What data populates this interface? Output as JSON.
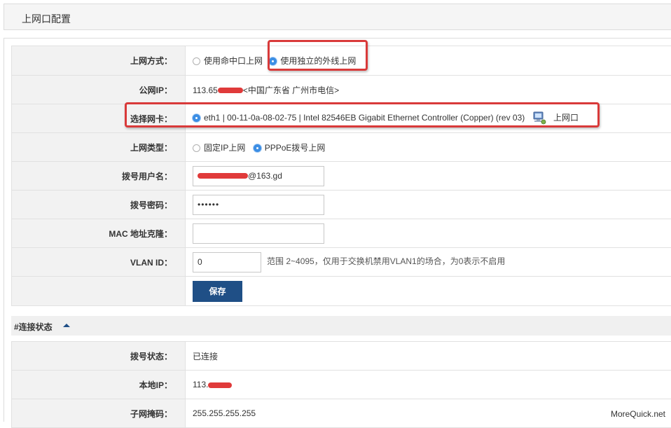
{
  "header": {
    "title": "上网口配置"
  },
  "form": {
    "access_mode": {
      "label": "上网方式：",
      "option1": "使用命中口上网",
      "option2": "使用独立的外线上网",
      "selected": "option2"
    },
    "public_ip": {
      "label": "公网IP：",
      "prefix": "113.65",
      "suffix": "<中国广东省 广州市电信>"
    },
    "nic": {
      "label": "选择网卡：",
      "value": "eth1 | 00-11-0a-08-02-75 | Intel 82546EB Gigabit Ethernet Controller (Copper) (rev 03)",
      "tag": "上网口",
      "icon": "network-computer-icon"
    },
    "conn_type": {
      "label": "上网类型：",
      "option1": "固定IP上网",
      "option2": "PPPoE拨号上网",
      "selected": "option2"
    },
    "username": {
      "label": "拨号用户名：",
      "suffix": "@163.gd"
    },
    "password": {
      "label": "拨号密码：",
      "value": "••••••"
    },
    "mac_clone": {
      "label": "MAC 地址克隆：",
      "value": ""
    },
    "vlan": {
      "label": "VLAN ID：",
      "value": "0",
      "hint": "范围 2~4095，仅用于交换机禁用VLAN1的场合，为0表示不启用"
    },
    "save_label": "保存"
  },
  "status_section": {
    "title": "#连接状态",
    "rows": [
      {
        "label": "拨号状态：",
        "value": "已连接"
      },
      {
        "label": "本地IP：",
        "value": "113."
      },
      {
        "label": "子网掩码：",
        "value": "255.255.255.255"
      }
    ]
  },
  "watermark": "MoreQuick.net",
  "colors": {
    "accent": "#3c8ee4",
    "button": "#1f4f86",
    "highlight": "#d93a3a",
    "redact": "#e03a3a"
  }
}
